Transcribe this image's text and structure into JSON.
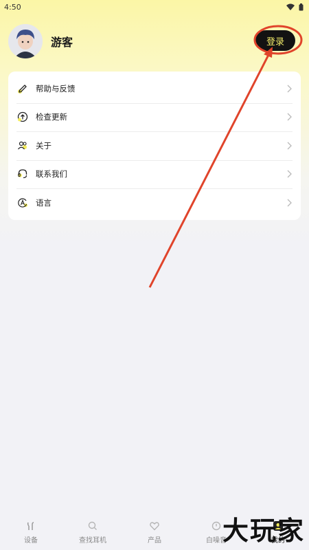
{
  "status_bar": {
    "time": "4:50"
  },
  "profile": {
    "username": "游客",
    "login_label": "登录"
  },
  "menu": [
    {
      "label": "帮助与反馈",
      "icon": "edit-icon"
    },
    {
      "label": "检查更新",
      "icon": "update-icon"
    },
    {
      "label": "关于",
      "icon": "about-icon"
    },
    {
      "label": "联系我们",
      "icon": "headset-icon"
    },
    {
      "label": "语言",
      "icon": "language-icon"
    }
  ],
  "tabs": [
    {
      "label": "设备",
      "icon": "device-icon"
    },
    {
      "label": "查找耳机",
      "icon": "find-icon"
    },
    {
      "label": "产品",
      "icon": "heart-icon"
    },
    {
      "label": "白噪音",
      "icon": "timer-icon"
    },
    {
      "label": "我的",
      "icon": "profile-icon"
    }
  ],
  "watermark": "大玩家",
  "colors": {
    "accent": "#f2ec6a",
    "annotation": "#e0442b"
  }
}
